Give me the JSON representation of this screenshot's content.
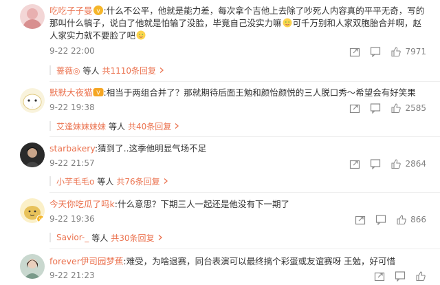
{
  "comments": [
    {
      "name": "吃吃子子曼",
      "text_1": "什么不公平，他就是能力差，每次拿个吉他上去除了吵死人内容真的平平无奇，写的那叫什么犒子，说白了他就是怕输了没脸，毕竟自己没实力嘛",
      "text_2": "可千万别和人家双胞胎合并啊，赵人家实力就不要脸了吧",
      "date": "9-22 22:00",
      "likes": "7971",
      "reply_name": "蔷薇◎",
      "reply_mid": "等人",
      "reply_link": "共1110条回复"
    },
    {
      "name": "默默大夜猫",
      "text_1": "相当于两组合并了？那就期待后面王勉和颜怡颜悦的三人脱口秀～希望会有好笑果",
      "date": "9-22 19:38",
      "likes": "2585",
      "reply_name": "艾逢妹妹妹妹",
      "reply_mid": "等人",
      "reply_link": "共40条回复"
    },
    {
      "name": "starbakery",
      "text_1": "猜到了..这季他明显气场不足",
      "date": "9-22 21:57",
      "likes": "2864",
      "reply_name": "小芋毛毛o",
      "reply_mid": "等人",
      "reply_link": "共76条回复"
    },
    {
      "name": "今天你吃瓜了吗k",
      "text_1": "什么意思？下期三人一起还是他没有下一期了",
      "date": "9-22 19:36",
      "likes": "866",
      "reply_name": "Savior-_",
      "reply_mid": "等人",
      "reply_link": "共30条回复"
    },
    {
      "name": "forever伊司园梦蕉",
      "text_1": "难受，为啥退赛，同台表演可以最终搞个彩蛋或友谊赛呀 王勉，好可惜",
      "date": "9-22 21:23",
      "likes": "",
      "reply_name": "",
      "reply_mid": "",
      "reply_link": ""
    }
  ],
  "colors": {
    "accent": "#eb7350",
    "meta": "#808080",
    "text": "#333333"
  },
  "icons": [
    "share-icon",
    "comment-icon",
    "like-icon",
    "chevron-right-icon",
    "vip-badge-icon",
    "shy-emoji-icon"
  ]
}
